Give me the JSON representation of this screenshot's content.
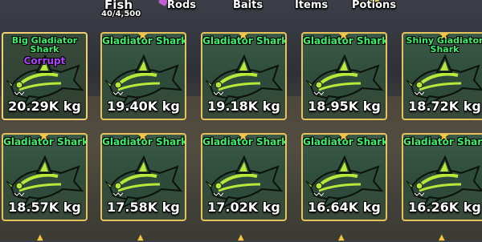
{
  "tabs": {
    "fish": "Fish",
    "fish_count": "40/4,500",
    "rods": "Rods",
    "baits": "Baits",
    "items": "Items",
    "potions": "Potions"
  },
  "colors": {
    "name_green": "#3cf06a",
    "border_gold": "#e6c25a",
    "mutation_purple": "#b040ff",
    "star_gold": "#f5c542"
  },
  "fish": [
    {
      "name": "Big Gladiator Shark",
      "mutation": "Corrupt",
      "weight": "20.29K kg"
    },
    {
      "name": "Gladiator Shark",
      "weight": "19.40K kg"
    },
    {
      "name": "Gladiator Shark",
      "weight": "19.18K kg"
    },
    {
      "name": "Gladiator Shark",
      "weight": "18.95K kg"
    },
    {
      "name": "Shiny Gladiator Shark",
      "weight": "18.72K kg"
    },
    {
      "name": "Gladiator Shark",
      "weight": "18.57K kg"
    },
    {
      "name": "Gladiator Shark",
      "weight": "17.58K kg"
    },
    {
      "name": "Gladiator Shark",
      "weight": "17.02K kg"
    },
    {
      "name": "Gladiator Shark",
      "weight": "16.64K kg"
    },
    {
      "name": "Gladiator Shark",
      "weight": "16.26K kg"
    }
  ]
}
